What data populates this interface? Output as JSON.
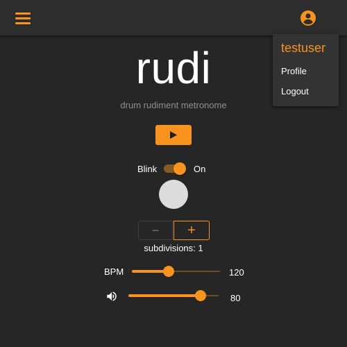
{
  "header": {
    "menu_icon": "hamburger-menu-icon",
    "account_icon": "account-circle-icon"
  },
  "user_menu": {
    "username": "testuser",
    "items": [
      {
        "label": "Profile"
      },
      {
        "label": "Logout"
      }
    ]
  },
  "app": {
    "title": "rudi",
    "subtitle": "drum rudiment metronome"
  },
  "controls": {
    "play_icon": "play-icon",
    "blink": {
      "label": "Blink",
      "state_label": "On",
      "enabled": true
    },
    "subdivisions": {
      "label": "subdivisions:",
      "value": "1",
      "minus": "−",
      "plus": "+"
    },
    "bpm": {
      "label": "BPM",
      "value": "120",
      "fraction": 0.42
    },
    "volume": {
      "icon": "volume-up-icon",
      "value": "80",
      "fraction": 0.8
    }
  },
  "colors": {
    "accent": "#f7931e",
    "background": "#262626",
    "topbar": "#2d2d2d",
    "menu_background": "#333333",
    "blink_indicator": "#dcdcdc"
  }
}
